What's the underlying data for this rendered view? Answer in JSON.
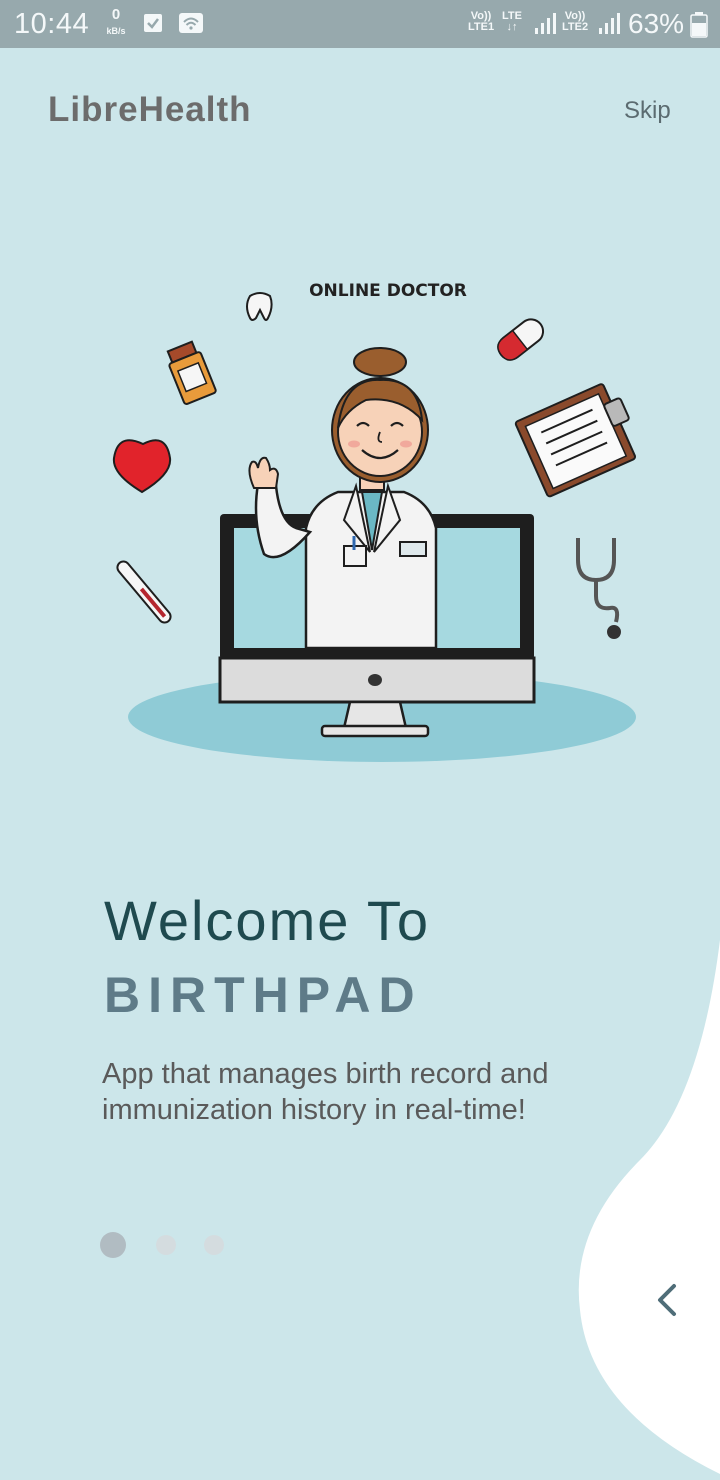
{
  "status_bar": {
    "time": "10:44",
    "speed_value": "0",
    "speed_unit": "kB/s",
    "lte1_top": "Vo))",
    "lte1_bottom": "LTE1",
    "lte_top": "LTE",
    "lte_bottom": "↓↑",
    "lte2_top": "Vo))",
    "lte2_bottom": "LTE2",
    "battery": "63%"
  },
  "header": {
    "brand": "LibreHealth",
    "skip_label": "Skip"
  },
  "illustration": {
    "caption": "ONLINE DOCTOR"
  },
  "main": {
    "welcome": "Welcome To",
    "app_name": "BIRTHPAD",
    "description": "App that manages birth record and immunization history in real-time!"
  },
  "pager": {
    "current": 1,
    "total": 3
  },
  "colors": {
    "background": "#cce6ea",
    "status_bar": "#97a9ad",
    "accent": "#5e7b88",
    "wave": "#ffffff"
  },
  "icons": {
    "back": "chevron-left-icon"
  }
}
